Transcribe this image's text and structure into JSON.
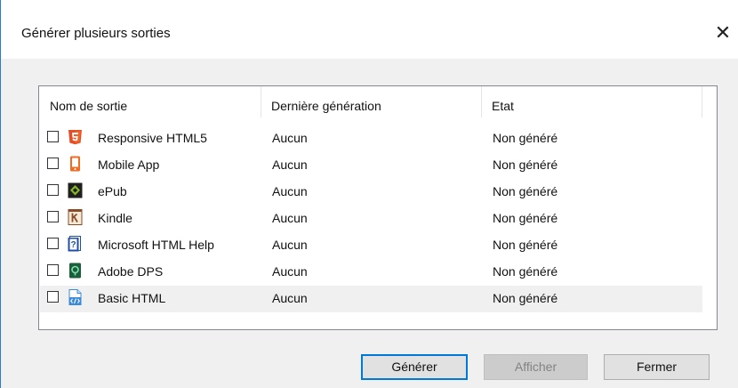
{
  "dialog": {
    "title": "Générer plusieurs sorties",
    "close_glyph": "✕"
  },
  "table": {
    "columns": [
      "Nom de sortie",
      "Dernière génération",
      "Etat"
    ],
    "rows": [
      {
        "name": "Responsive HTML5",
        "last": "Aucun",
        "state": "Non généré",
        "icon": "html5-icon",
        "checked": false
      },
      {
        "name": "Mobile App",
        "last": "Aucun",
        "state": "Non généré",
        "icon": "mobile-app-icon",
        "checked": false
      },
      {
        "name": "ePub",
        "last": "Aucun",
        "state": "Non généré",
        "icon": "epub-icon",
        "checked": false
      },
      {
        "name": "Kindle",
        "last": "Aucun",
        "state": "Non généré",
        "icon": "kindle-icon",
        "checked": false
      },
      {
        "name": "Microsoft HTML Help",
        "last": "Aucun",
        "state": "Non généré",
        "icon": "html-help-icon",
        "checked": false
      },
      {
        "name": "Adobe DPS",
        "last": "Aucun",
        "state": "Non généré",
        "icon": "adobe-dps-icon",
        "checked": false
      },
      {
        "name": "Basic HTML",
        "last": "Aucun",
        "state": "Non généré",
        "icon": "basic-html-icon",
        "checked": false,
        "selected": true
      }
    ]
  },
  "buttons": {
    "generate": "Générer",
    "show": "Afficher",
    "close": "Fermer"
  },
  "colors": {
    "accent": "#0078d7",
    "html5": "#e44d26",
    "mobile": "#f26b21",
    "epub": "#84b82a",
    "kindle": "#8a4b2a",
    "htmlhelp": "#1f4fa8",
    "dps": "#1b5e3b",
    "basichtml": "#3c8ad8"
  }
}
